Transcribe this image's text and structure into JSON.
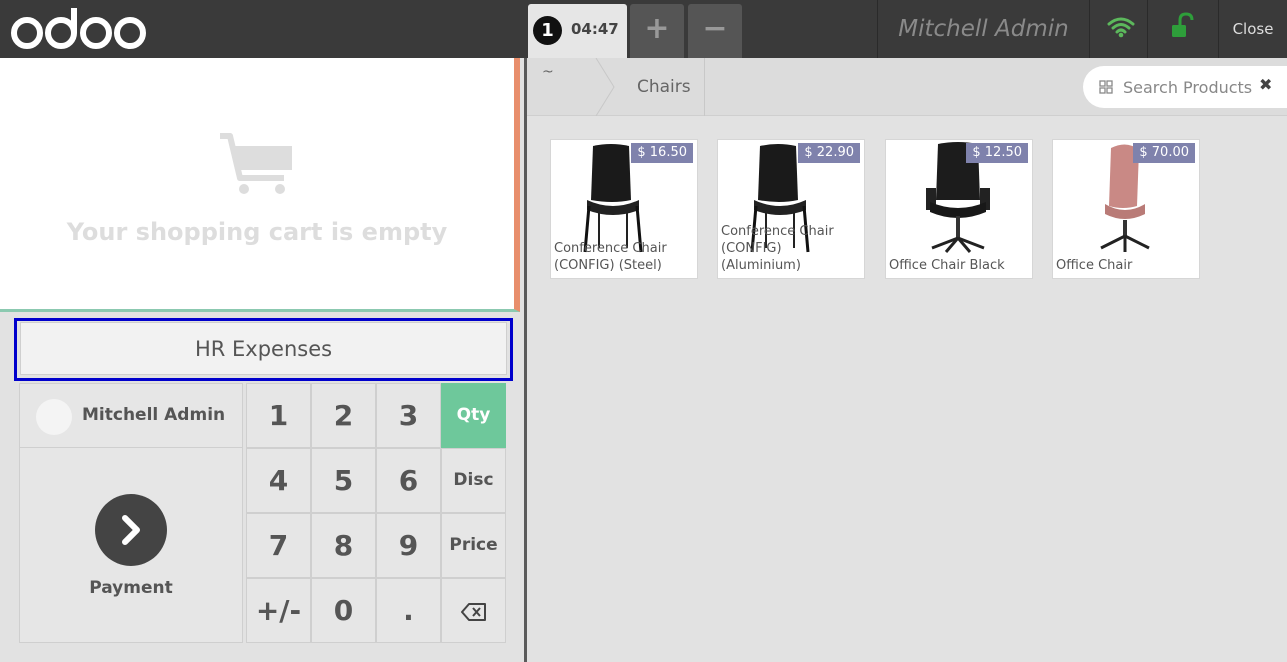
{
  "header": {
    "order_number": "1",
    "order_time": "04:47",
    "add_order": "+",
    "remove_order": "−",
    "user_name": "Mitchell Admin",
    "close_label": "Close",
    "wifi_color": "#5cb85c",
    "lock_color": "#2e9e3a",
    "icons": [
      "odoo-logo",
      "wifi-icon",
      "lock-icon"
    ]
  },
  "cart": {
    "empty_message": "Your shopping cart is empty",
    "icon": "cart-icon"
  },
  "actions": {
    "hr_expenses": "HR Expenses"
  },
  "customer": {
    "name": "Mitchell Admin"
  },
  "payment": {
    "label": "Payment",
    "icon": "chevron-right-icon"
  },
  "numpad": {
    "keys": [
      "1",
      "2",
      "3",
      "Qty",
      "4",
      "5",
      "6",
      "Disc",
      "7",
      "8",
      "9",
      "Price",
      "+/-",
      "0",
      "."
    ],
    "active_mode": "Qty",
    "accent": "#6ec89b"
  },
  "breadcrumb": {
    "home": "~",
    "category": "Chairs"
  },
  "search": {
    "placeholder": "Search Products..."
  },
  "products": [
    {
      "name": "Conference Chair (CONFIG) (Steel)",
      "price": "$ 16.50"
    },
    {
      "name": "Conference Chair (CONFIG) (Aluminium)",
      "price": "$ 22.90"
    },
    {
      "name": "Office Chair Black",
      "price": "$ 12.50"
    },
    {
      "name": "Office Chair",
      "price": "$ 70.00"
    }
  ]
}
